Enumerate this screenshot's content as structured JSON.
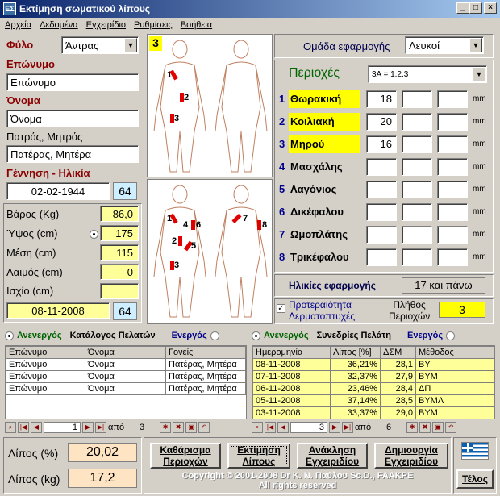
{
  "window": {
    "title": "Εκτίμηση σωματικού λίπους",
    "icon_text": "ΕΣ"
  },
  "menu": [
    "Αρχεία",
    "Δεδομένα",
    "Εγχειρίδιο",
    "Ρυθμίσεις",
    "Βοήθεια"
  ],
  "patient": {
    "sex_label": "Φύλο",
    "sex_value": "Άντρας",
    "surname_label": "Επώνυμο",
    "surname_value": "Επώνυμο",
    "name_label": "Όνομα",
    "name_value": "Όνομα",
    "parents_label": "Πατρός, Μητρός",
    "parents_value": "Πατέρας, Μητέρα",
    "birth_label": "Γέννηση - Ηλικία",
    "birth_value": "02-02-1944",
    "age": "64",
    "weight_label": "Βάρος (Kg)",
    "weight_value": "86,0",
    "height_label": "Ύψος (cm)",
    "height_value": "175",
    "waist_label": "Μέση (cm)",
    "waist_value": "115",
    "neck_label": "Λαιμός (cm)",
    "neck_value": "0",
    "hip_label": "Ισχίο (cm)",
    "hip_value": "",
    "date_value": "08-11-2008",
    "date_age": "64"
  },
  "image_panel": {
    "badge": "3"
  },
  "group": {
    "label": "Ομάδα εφαρμογής",
    "value": "Λευκοί"
  },
  "regions": {
    "label": "Περιοχές",
    "formula": "3A = 1.2.3",
    "unit": "mm",
    "items": [
      {
        "num": "1",
        "name": "Θωρακική",
        "v1": "18",
        "highlight": true
      },
      {
        "num": "2",
        "name": "Κοιλιακή",
        "v1": "20",
        "highlight": true
      },
      {
        "num": "3",
        "name": "Μηρού",
        "v1": "16",
        "highlight": true
      },
      {
        "num": "4",
        "name": "Μασχάλης",
        "v1": "",
        "highlight": false
      },
      {
        "num": "5",
        "name": "Λαγόνιος",
        "v1": "",
        "highlight": false
      },
      {
        "num": "6",
        "name": "Δικέφαλου",
        "v1": "",
        "highlight": false
      },
      {
        "num": "7",
        "name": "Ωμοπλάτης",
        "v1": "",
        "highlight": false
      },
      {
        "num": "8",
        "name": "Τρικέφαλου",
        "v1": "",
        "highlight": false
      }
    ]
  },
  "ages": {
    "label": "Ηλικίες εφαρμογής",
    "value": "17 και πάνω"
  },
  "priority": {
    "label_line1": "Προτεραιότητα",
    "label_line2": "Δερματοπτυχές",
    "count_label_line1": "Πλήθος",
    "count_label_line2": "Περιοχών",
    "count": "3"
  },
  "clients": {
    "inactive": "Ανενεργός",
    "title": "Κατάλογος Πελατών",
    "active": "Ενεργός",
    "columns": [
      "Επώνυμο",
      "Όνομα",
      "Γονείς"
    ],
    "rows": [
      [
        "Επώνυμο",
        "Όνομα",
        "Πατέρας, Μητέρα"
      ],
      [
        "Επώνυμο",
        "Όνομα",
        "Πατέρας, Μητέρα"
      ],
      [
        "Επώνυμο",
        "Όνομα",
        "Πατέρας, Μητέρα"
      ]
    ],
    "nav_pos": "1",
    "nav_of": "από",
    "nav_total": "3"
  },
  "sessions": {
    "inactive": "Ανενεργός",
    "title": "Συνεδρίες Πελάτη",
    "active": "Ενεργός",
    "columns": [
      "Ημερομηνία",
      "Λίπος [%]",
      "ΔΣΜ",
      "Μέθοδος"
    ],
    "rows": [
      [
        "08-11-2008",
        "36,21%",
        "28,1",
        "ΒΥ"
      ],
      [
        "07-11-2008",
        "32,37%",
        "27,9",
        "ΒΥΜ"
      ],
      [
        "06-11-2008",
        "23,46%",
        "28,4",
        "ΔΠ"
      ],
      [
        "05-11-2008",
        "37,14%",
        "28,5",
        "ΒΥΜΛ"
      ],
      [
        "03-11-2008",
        "33,37%",
        "29,0",
        "ΒΥΜ"
      ]
    ],
    "nav_pos": "3",
    "nav_of": "από",
    "nav_total": "6"
  },
  "results": {
    "fat_pct_label": "Λίπος (%)",
    "fat_pct": "20,02",
    "fat_kg_label": "Λίπος (kg)",
    "fat_kg": "17,2"
  },
  "buttons": {
    "clear_l1": "Καθάρισμα",
    "clear_l2": "Περιοχών",
    "estimate_l1": "Εκτίμηση",
    "estimate_l2": "Λίπους",
    "recall_l1": "Ανάκληση",
    "recall_l2": "Εγχειριδίου",
    "create_l1": "Δημιουργία",
    "create_l2": "Εγχειριδίου",
    "exit": "Τέλος"
  },
  "copyright_l1": "Copyright © 2001-2008 Dr K. N. Παύλου Sc.D., FAAKPE",
  "copyright_l2": "All rights reserved"
}
